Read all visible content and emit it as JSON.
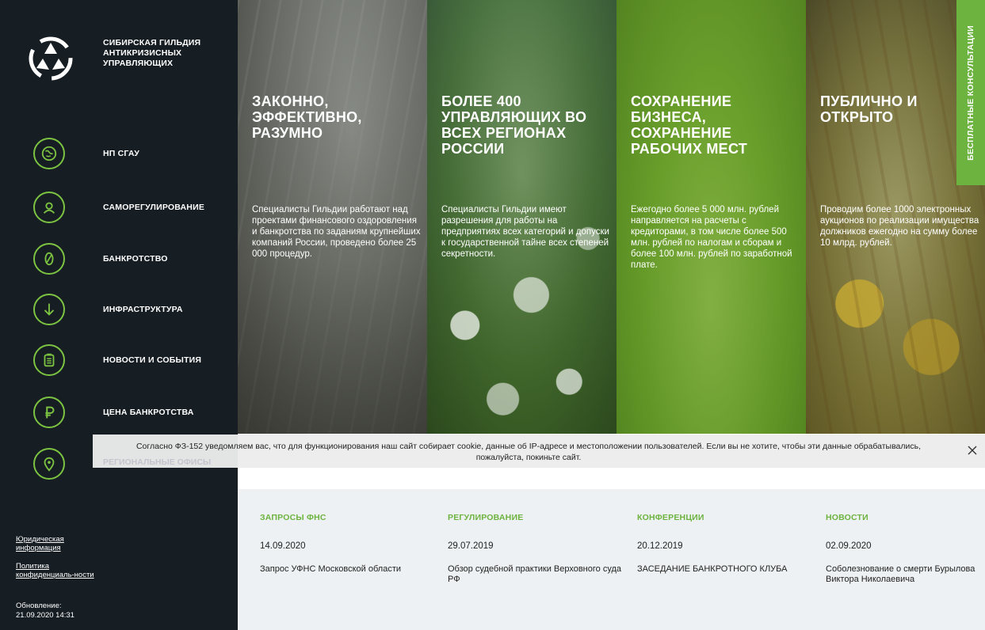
{
  "brand": {
    "name": "СИБИРСКАЯ ГИЛЬДИЯ АНТИКРИЗИСНЫХ УПРАВЛЯЮЩИХ"
  },
  "nav": [
    {
      "label": "НП СГАУ",
      "icon": "globe-icon"
    },
    {
      "label": "САМОРЕГУЛИРОВАНИЕ",
      "icon": "person-icon"
    },
    {
      "label": "БАНКРОТСТВО",
      "icon": "zero-icon"
    },
    {
      "label": "ИНФРАСТРУКТУРА",
      "icon": "arrow-down-icon"
    },
    {
      "label": "НОВОСТИ И СОБЫТИЯ",
      "icon": "clipboard-icon"
    },
    {
      "label": "ЦЕНА БАНКРОТСТВА",
      "icon": "ruble-icon"
    },
    {
      "label": "РЕГИОНАЛЬНЫЕ ОФИСЫ",
      "icon": "location-pin-icon"
    }
  ],
  "sidebar_footer": {
    "legal": "Юридическая информация",
    "privacy": "Политика конфиденциаль-ности",
    "update_label": "Обновление:",
    "update_value": "21.09.2020 14:31"
  },
  "panels": [
    {
      "title": "ЗАКОННО, ЭФФЕКТИВНО, РАЗУМНО",
      "text": "Специалисты Гильдии работают над проектами финансового оздоровления и банкротства по заданиям крупнейших компаний России, проведено более 25 000 процедур."
    },
    {
      "title": "БОЛЕЕ 400 УПРАВЛЯЮЩИХ ВО ВСЕХ РЕГИОНАХ РОССИИ",
      "text": "Специалисты Гильдии имеют разрешения для работы на предприятиях всех категорий и допуски к государственной тайне всех степеней секретности."
    },
    {
      "title": "СОХРАНЕНИЕ БИЗНЕСА, СОХРАНЕНИЕ РАБОЧИХ МЕСТ",
      "text": "Ежегодно более 5 000 млн. рублей направляется на расчеты с кредиторами, в том числе более 500 млн. рублей по налогам и сборам и более 100 млн. рублей по заработной плате."
    },
    {
      "title": "ПУБЛИЧНО И ОТКРЫТО",
      "text": "Проводим более 1000 электронных аукционов по реализации имущества должников ежегодно на сумму более 10 млрд. рублей."
    }
  ],
  "consult_tab": "БЕСПЛАТНЫЕ КОНСУЛЬТАЦИИ",
  "cookie": {
    "text": "Согласно ФЗ-152 уведомляем вас, что для функционирования наш сайт собирает cookie, данные об IP-адресе и местоположении пользователей. Если вы не хотите, чтобы эти данные обрабатывались, пожалуйста, покиньте сайт."
  },
  "news": [
    {
      "category": "ЗАПРОСЫ ФНС",
      "date": "14.09.2020",
      "title": "Запрос УФНС Московской области"
    },
    {
      "category": "РЕГУЛИРОВАНИЕ",
      "date": "29.07.2019",
      "title": "Обзор судебной практики Верховного суда РФ"
    },
    {
      "category": "КОНФЕРЕНЦИИ",
      "date": "20.12.2019",
      "title": "ЗАСЕДАНИЕ БАНКРОТНОГО КЛУБА"
    },
    {
      "category": "НОВОСТИ",
      "date": "02.09.2020",
      "title": "Соболезнование о смерти Бурылова Виктора Николаевича"
    }
  ],
  "colors": {
    "accent": "#6cb33f",
    "sidebar": "#161d23",
    "news_bg": "#eef1f3"
  }
}
